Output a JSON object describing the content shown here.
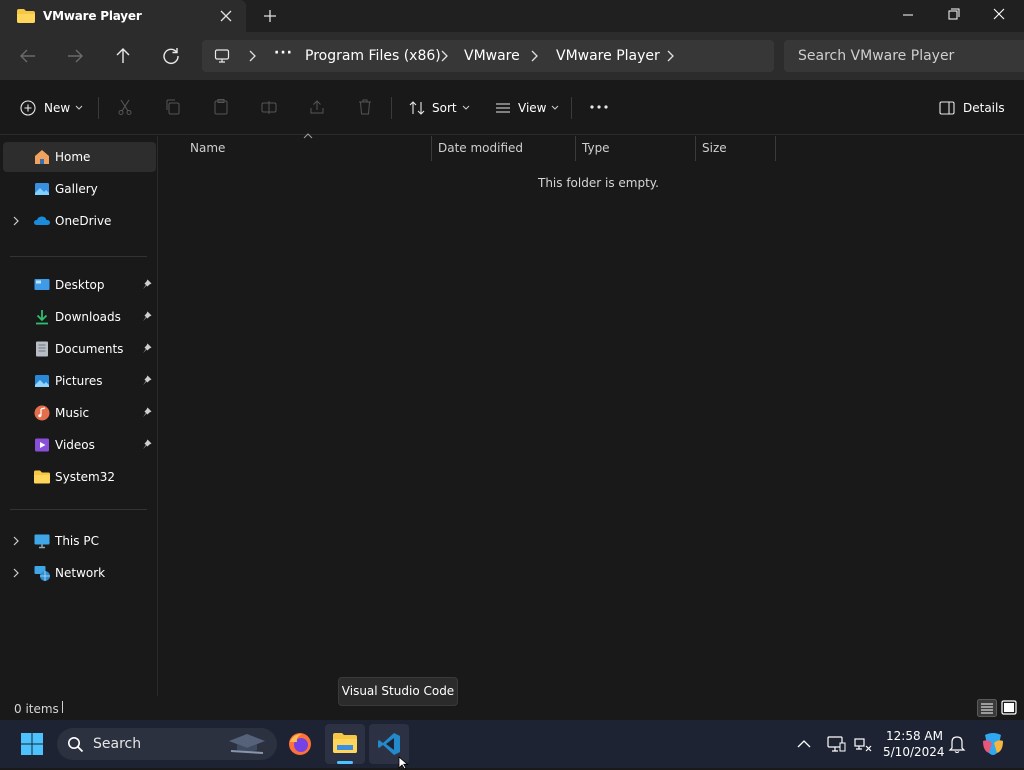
{
  "window": {
    "tab_title": "VMware Player",
    "tab_icon": "folder-icon",
    "controls": [
      "minimize-icon",
      "restore-icon",
      "close-icon"
    ]
  },
  "address": {
    "breadcrumbs": [
      "Program Files (x86)",
      "VMware",
      "VMware Player"
    ],
    "search_placeholder": "Search VMware Player"
  },
  "commands": {
    "new_label": "New",
    "sort_label": "Sort",
    "view_label": "View",
    "details_label": "Details"
  },
  "nav": {
    "home": "Home",
    "gallery": "Gallery",
    "onedrive": "OneDrive",
    "pinned": [
      {
        "label": "Desktop",
        "icon": "desktop-icon"
      },
      {
        "label": "Downloads",
        "icon": "downloads-icon"
      },
      {
        "label": "Documents",
        "icon": "documents-icon"
      },
      {
        "label": "Pictures",
        "icon": "pictures-icon"
      },
      {
        "label": "Music",
        "icon": "music-icon"
      },
      {
        "label": "Videos",
        "icon": "videos-icon"
      },
      {
        "label": "System32",
        "icon": "folder-icon"
      }
    ],
    "this_pc": "This PC",
    "network": "Network"
  },
  "columns": {
    "name": "Name",
    "date_modified": "Date modified",
    "type": "Type",
    "size": "Size"
  },
  "content": {
    "empty_message": "This folder is empty."
  },
  "status": {
    "item_count": "0 items"
  },
  "tooltip": {
    "text": "Visual Studio Code"
  },
  "taskbar": {
    "search_label": "Search",
    "time": "12:58 AM",
    "date": "5/10/2024"
  },
  "colors": {
    "accent": "#4cc2ff",
    "taskbar_bg": "#1d2332"
  }
}
